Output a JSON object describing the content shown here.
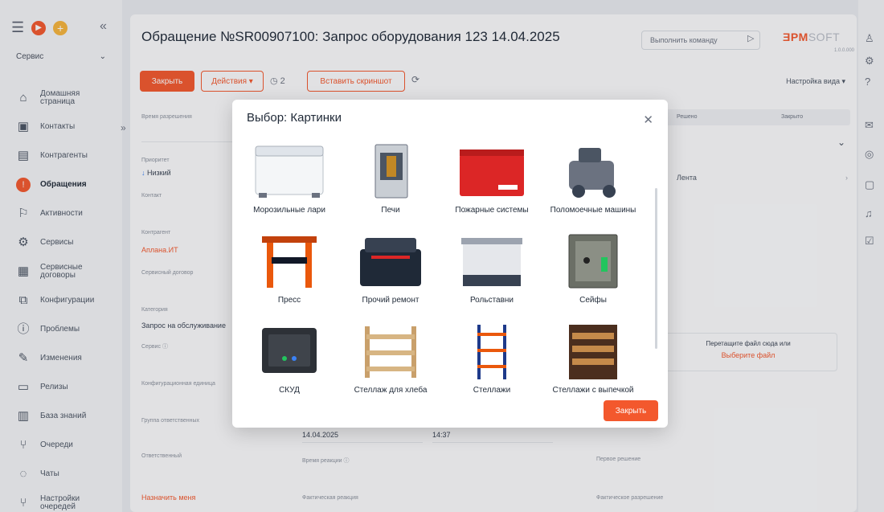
{
  "sidebar": {
    "workspace": "Сервис",
    "items": [
      {
        "label": "Домашняя страница",
        "icon": "home-icon"
      },
      {
        "label": "Контакты",
        "icon": "contact-icon"
      },
      {
        "label": "Контрагенты",
        "icon": "accounts-icon"
      },
      {
        "label": "Обращения",
        "icon": "cases-icon",
        "active": true
      },
      {
        "label": "Активности",
        "icon": "flag-icon"
      },
      {
        "label": "Сервисы",
        "icon": "gear-icon"
      },
      {
        "label": "Сервисные договоры",
        "icon": "contract-icon"
      },
      {
        "label": "Конфигурации",
        "icon": "config-icon"
      },
      {
        "label": "Проблемы",
        "icon": "problem-icon"
      },
      {
        "label": "Изменения",
        "icon": "pencil-icon"
      },
      {
        "label": "Релизы",
        "icon": "release-icon"
      },
      {
        "label": "База знаний",
        "icon": "knowledge-icon"
      },
      {
        "label": "Очереди",
        "icon": "queue-icon"
      },
      {
        "label": "Чаты",
        "icon": "chat-icon"
      },
      {
        "label": "Настройки очередей",
        "icon": "queue-settings-icon"
      }
    ]
  },
  "header": {
    "title": "Обращение №SR00907100: Запрос оборудования 123 14.04.2025",
    "command_placeholder": "Выполнить команду",
    "logo_main": "ƎPM",
    "logo_tail": "SOFT",
    "version": "1.0.0.000"
  },
  "toolbar": {
    "close_label": "Закрыть",
    "actions_label": "Действия ▾",
    "counter": "2",
    "screenshot_label": "Вставить скриншот",
    "view_settings": "Настройка вида ▾"
  },
  "fields": {
    "resolution_time": "Время разрешения",
    "priority_label": "Приоритет",
    "priority_value": "Низкий",
    "contact_label": "Контакт",
    "account_label": "Контрагент",
    "account_value": "Аплана.ИТ",
    "contract_label": "Сервисный договор",
    "category_label": "Категория",
    "category_value": "Запрос на обслуживание",
    "service_label": "Сервис",
    "config_label": "Конфигурационная единица",
    "group_label": "Группа ответственных",
    "owner_label": "Ответственный",
    "assign_me": "Назначить меня",
    "date_value": "14.04.2025",
    "time_value": "14:37",
    "reaction_time": "Время реакции",
    "first_resolution": "Первое решение",
    "actual_reaction": "Фактическая реакция",
    "actual_resolution": "Фактическое разрешение",
    "resolved": "Решено",
    "closed": "Закрыто",
    "feed": "Лента",
    "drop_text": "Перетащите файл сюда или",
    "choose_file": "Выберите файл"
  },
  "modal": {
    "title": "Выбор: Картинки",
    "close_button": "Закрыть",
    "items": [
      {
        "label": "Морозильные лари"
      },
      {
        "label": "Печи"
      },
      {
        "label": "Пожарные системы"
      },
      {
        "label": "Поломоечные машины"
      },
      {
        "label": "Пресс"
      },
      {
        "label": "Прочий ремонт"
      },
      {
        "label": "Рольставни"
      },
      {
        "label": "Сейфы"
      },
      {
        "label": "СКУД"
      },
      {
        "label": "Стеллаж для хлеба"
      },
      {
        "label": "Стеллажи"
      },
      {
        "label": "Стеллажи с выпечкой"
      }
    ]
  },
  "colors": {
    "accent": "#f3582d",
    "text": "#1f2937"
  }
}
